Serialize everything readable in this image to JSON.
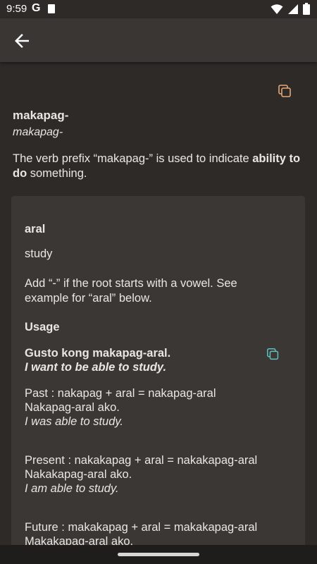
{
  "status": {
    "time": "9:59",
    "g_letter": "G"
  },
  "colors": {
    "accent_top": "#e7a878",
    "accent_card": "#5fc2bf",
    "background": "#2d2a28",
    "card": "#3a3735"
  },
  "icons": {
    "back": "arrow-left-icon",
    "copy": "copy-icon",
    "wifi": "wifi-icon",
    "signal": "signal-icon",
    "battery": "battery-icon"
  },
  "entry": {
    "term": "makapag-",
    "term_italic": "makapag-",
    "desc_pre": "The verb prefix “makapag-” is used to indicate ",
    "desc_bold": "ability to do",
    "desc_post": " something."
  },
  "card": {
    "root": "aral",
    "root_meaning": "study",
    "note": "Add “-” if the root starts with a vowel. See example for “aral” below.",
    "usage_heading": "Usage",
    "example_sentence": "Gusto kong makapag-aral.",
    "example_translation": "I want to be able to study.",
    "past_formula": "Past : nakapag + aral = nakapag-aral",
    "past_sentence": "Nakapag-aral ako.",
    "past_translation": "I was able to study.",
    "present_formula": "Present : nakakapag + aral = nakakapag-aral",
    "present_sentence": "Nakakapag-aral ako.",
    "present_translation": "I am able to study.",
    "future_formula": "Future : makakapag + aral = makakapag-aral",
    "future_sentence": "Makakapag-aral ako."
  }
}
